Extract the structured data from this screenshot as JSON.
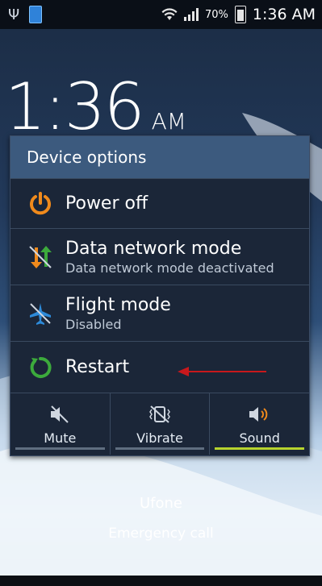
{
  "status_bar": {
    "battery_percent": "70%",
    "time": "1:36 AM"
  },
  "lockscreen": {
    "time": "1:36",
    "ampm": "AM",
    "carrier": "Ufone",
    "emergency_call": "Emergency call"
  },
  "dialog": {
    "title": "Device options",
    "items": [
      {
        "label": "Power off",
        "icon": "power-icon",
        "color": "#f08a1c"
      },
      {
        "label": "Data network mode",
        "sub": "Data network mode deactivated",
        "icon": "data-network-icon"
      },
      {
        "label": "Flight mode",
        "sub": "Disabled",
        "icon": "airplane-icon",
        "color": "#2d8ad9"
      },
      {
        "label": "Restart",
        "icon": "restart-icon",
        "color": "#3caa3c"
      }
    ],
    "sound_modes": [
      {
        "label": "Mute",
        "icon": "mute-icon",
        "active": false
      },
      {
        "label": "Vibrate",
        "icon": "vibrate-icon",
        "active": false
      },
      {
        "label": "Sound",
        "icon": "sound-icon",
        "active": true
      }
    ],
    "active_indicator_color": "#b7d32e"
  },
  "annotation": {
    "arrow_color": "#c8181c"
  }
}
